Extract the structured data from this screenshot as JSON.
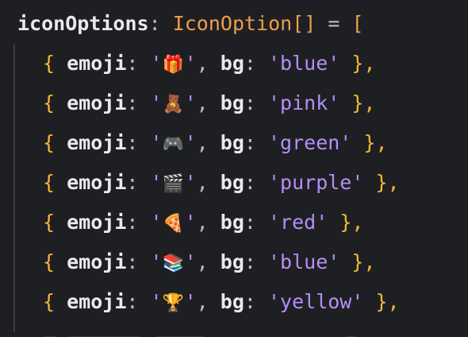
{
  "code": {
    "header": {
      "identifier": "iconOptions",
      "colon": ":",
      "type_name": "IconOption",
      "type_brackets": "[]",
      "assign": "=",
      "open_bracket": "["
    },
    "items": [
      {
        "open": "{",
        "emoji_key": "emoji",
        "colon1": ":",
        "emoji": "🎁",
        "comma1": ",",
        "bg_key": "bg",
        "colon2": ":",
        "bg": "'blue'",
        "close": "},",
        "emoji_icon": "gift-icon"
      },
      {
        "open": "{",
        "emoji_key": "emoji",
        "colon1": ":",
        "emoji": "🧸",
        "comma1": ",",
        "bg_key": "bg",
        "colon2": ":",
        "bg": "'pink'",
        "close": "},",
        "emoji_icon": "teddy-bear-icon"
      },
      {
        "open": "{",
        "emoji_key": "emoji",
        "colon1": ":",
        "emoji": "🎮",
        "comma1": ",",
        "bg_key": "bg",
        "colon2": ":",
        "bg": "'green'",
        "close": "},",
        "emoji_icon": "game-controller-icon"
      },
      {
        "open": "{",
        "emoji_key": "emoji",
        "colon1": ":",
        "emoji": "🎬",
        "comma1": ",",
        "bg_key": "bg",
        "colon2": ":",
        "bg": "'purple'",
        "close": "},",
        "emoji_icon": "clapper-board-icon"
      },
      {
        "open": "{",
        "emoji_key": "emoji",
        "colon1": ":",
        "emoji": "🍕",
        "comma1": ",",
        "bg_key": "bg",
        "colon2": ":",
        "bg": "'red'",
        "close": "},",
        "emoji_icon": "pizza-icon"
      },
      {
        "open": "{",
        "emoji_key": "emoji",
        "colon1": ":",
        "emoji": "📚",
        "comma1": ",",
        "bg_key": "bg",
        "colon2": ":",
        "bg": "'blue'",
        "close": "},",
        "emoji_icon": "books-icon"
      },
      {
        "open": "{",
        "emoji_key": "emoji",
        "colon1": ":",
        "emoji": "🏆",
        "comma1": ",",
        "bg_key": "bg",
        "colon2": ":",
        "bg": "'yellow'",
        "close": "},",
        "emoji_icon": "trophy-icon"
      }
    ]
  },
  "theme": {
    "background": "#1e1f22",
    "property": "#e8eaee",
    "type": "#ee9d4a",
    "brace": "#f2b736",
    "string": "#b48ef7"
  }
}
